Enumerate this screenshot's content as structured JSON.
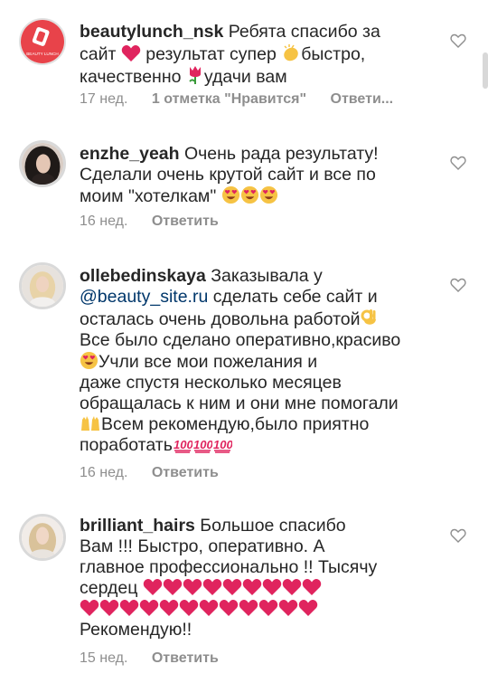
{
  "comments": [
    {
      "username": "beautylunch_nsk",
      "lines": [
        "Ребята спасибо за",
        "сайт",
        "результат супер",
        "быстро,",
        "качественно",
        "удачи вам"
      ],
      "time": "17 нед.",
      "likes": "1 отметка \"Нравится\"",
      "reply": "Ответи..."
    },
    {
      "username": "enzhe_yeah",
      "lines": [
        "Очень рада результату!",
        "Сделали очень крутой сайт и все по",
        "моим \"хотелкам\""
      ],
      "time": "16 нед.",
      "reply": "Ответить"
    },
    {
      "username": "ollebedinskaya",
      "lines": [
        "Заказывала у",
        "@beauty_site.ru",
        "сделать себе сайт и",
        "осталась очень довольна работой",
        "Все было сделано оперативно,красиво",
        "Учли все мои пожелания и",
        "даже спустя несколько месяцев",
        "обращалась к ним и они мне помогали",
        "Всем рекомендую,было приятно",
        "поработать"
      ],
      "time": "16 нед.",
      "reply": "Ответить"
    },
    {
      "username": "brilliant_hairs",
      "lines": [
        "Большое спасибо",
        "Вам !!! Быстро, оперативно. А",
        "главное профессионально !! Тысячу",
        "сердец",
        "Рекомендую!!"
      ],
      "time": "15 нед.",
      "reply": "Ответить"
    }
  ],
  "avatar_logo_text": "BEAUTY LUNCH",
  "colors": {
    "text": "#262626",
    "meta": "#8e8e8e",
    "mention": "#00376b",
    "heart_emoji": "#e0245e",
    "avatar_red": "#e8434a"
  }
}
